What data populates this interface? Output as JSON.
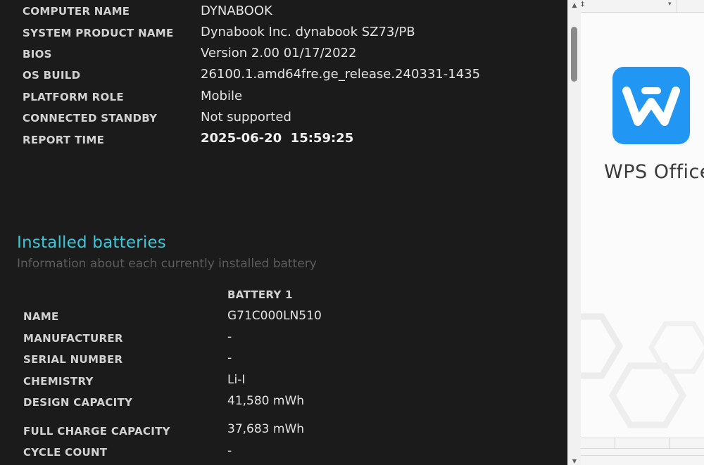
{
  "system_info": [
    {
      "label": "COMPUTER NAME",
      "value": "DYNABOOK"
    },
    {
      "label": "SYSTEM PRODUCT NAME",
      "value": "Dynabook Inc. dynabook SZ73/PB"
    },
    {
      "label": "BIOS",
      "value": "Version 2.00 01/17/2022"
    },
    {
      "label": "OS BUILD",
      "value": "26100.1.amd64fre.ge_release.240331-1435"
    },
    {
      "label": "PLATFORM ROLE",
      "value": "Mobile"
    },
    {
      "label": "CONNECTED STANDBY",
      "value": "Not supported"
    },
    {
      "label": "REPORT TIME",
      "value": "2025-06-20  15:59:25"
    }
  ],
  "batteries": {
    "title": "Installed batteries",
    "subtitle": "Information about each currently installed battery",
    "column_header": "BATTERY 1",
    "rows": [
      {
        "label": "NAME",
        "value": "G71C000LN510"
      },
      {
        "label": "MANUFACTURER",
        "value": "-"
      },
      {
        "label": "SERIAL NUMBER",
        "value": "-"
      },
      {
        "label": "CHEMISTRY",
        "value": "Li-I"
      },
      {
        "label": "DESIGN CAPACITY",
        "value": "41,580 mWh"
      },
      {
        "label": "FULL CHARGE CAPACITY",
        "value": "37,683 mWh"
      },
      {
        "label": "CYCLE COUNT",
        "value": "-"
      }
    ]
  },
  "wps": {
    "app_name": "WPS Office",
    "topbar_text": "‡",
    "logo_color": "#2196f3"
  },
  "colors": {
    "accent": "#39c7d9",
    "background": "#1b1b1b"
  }
}
